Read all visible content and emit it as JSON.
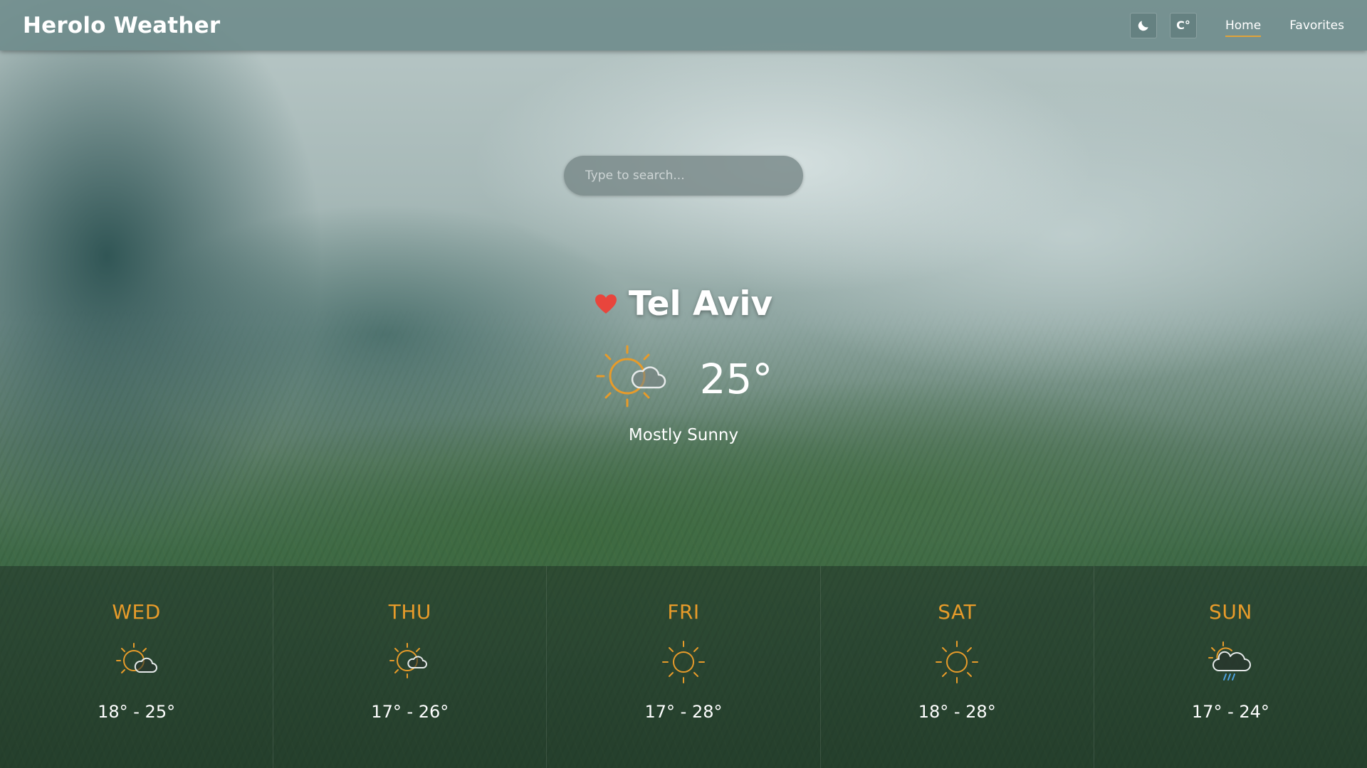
{
  "app": {
    "title": "Herolo Weather"
  },
  "navbar": {
    "theme_toggle_icon": "moon-icon",
    "unit_toggle_label": "C°",
    "links": [
      {
        "label": "Home",
        "active": true
      },
      {
        "label": "Favorites",
        "active": false
      }
    ]
  },
  "search": {
    "placeholder": "Type to search...",
    "value": ""
  },
  "current": {
    "city": "Tel Aviv",
    "favorite": true,
    "temperature": "25°",
    "condition": "Mostly Sunny",
    "icon": "partly-sunny-icon"
  },
  "forecast": [
    {
      "day": "WED",
      "range": "18° - 25°",
      "icon": "partly-sunny-icon"
    },
    {
      "day": "THU",
      "range": "17° - 26°",
      "icon": "partly-sunny-icon"
    },
    {
      "day": "FRI",
      "range": "17° - 28°",
      "icon": "sun-icon"
    },
    {
      "day": "SAT",
      "range": "18° - 28°",
      "icon": "sun-icon"
    },
    {
      "day": "SUN",
      "range": "17° - 24°",
      "icon": "rain-cloud-icon"
    }
  ],
  "colors": {
    "accent": "#e79b2a",
    "heart": "#e8453c",
    "navbar": "#6c8a8a"
  }
}
